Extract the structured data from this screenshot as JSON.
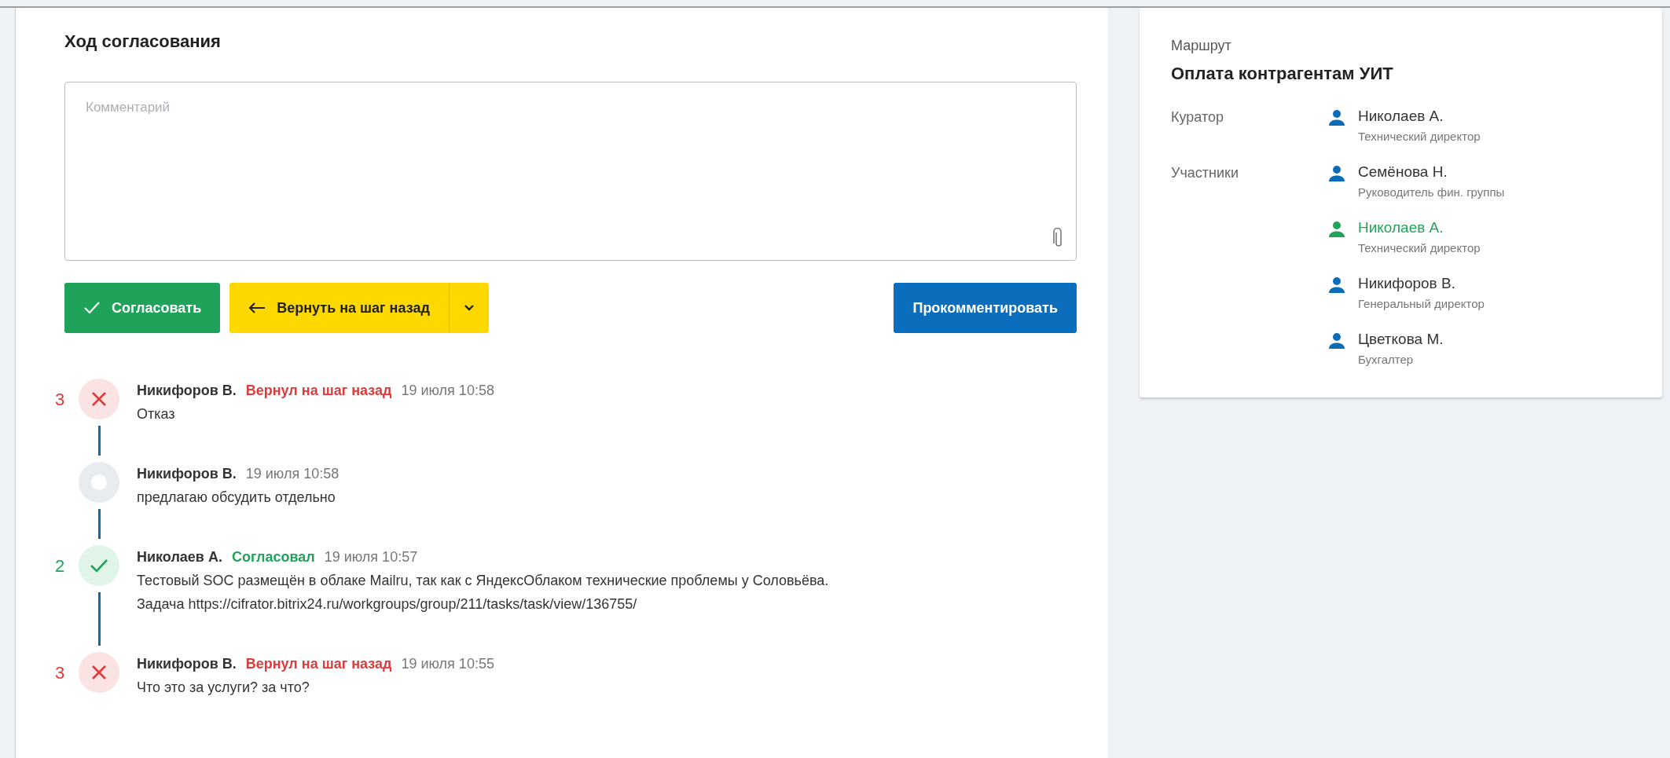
{
  "approval": {
    "title": "Ход согласования",
    "comment": {
      "placeholder": "Комментарий"
    },
    "buttons": [
      {
        "kind": "approve",
        "label": "Согласовать"
      },
      {
        "kind": "return",
        "label": "Вернуть на шаг назад"
      },
      {
        "kind": "comment",
        "label": "Прокомментировать"
      }
    ],
    "history": [
      {
        "kind": "rejected",
        "step": "3",
        "author": "Никифоров В.",
        "action": "Вернул на шаг назад",
        "date": "19 июля 10:58",
        "text": [
          "Отказ"
        ]
      },
      {
        "kind": "comment",
        "author": "Никифоров В.",
        "date": "19 июля 10:58",
        "text": [
          "предлагаю обсудить отдельно"
        ]
      },
      {
        "kind": "approved",
        "step": "2",
        "author": "Николаев А.",
        "action": "Согласовал",
        "date": "19 июля 10:57",
        "text": [
          "Тестовый SOC размещён в облаке Mailru, так как с ЯндексОблаком технические проблемы у Соловьёва.",
          "Задача https://cifrator.bitrix24.ru/workgroups/group/211/tasks/task/view/136755/"
        ]
      },
      {
        "kind": "rejected",
        "step": "3",
        "author": "Никифоров В.",
        "action": "Вернул на шаг назад",
        "date": "19 июля 10:55",
        "text": [
          "Что это за услуги? за что?"
        ]
      }
    ]
  },
  "route": {
    "label": "Маршрут",
    "name": "Оплата контрагентам УИТ",
    "groups": [
      {
        "role": "Куратор",
        "people": [
          {
            "name": "Николаев А.",
            "position": "Технический директор",
            "active": false
          }
        ]
      },
      {
        "role": "Участники",
        "people": [
          {
            "name": "Семёнова Н.",
            "position": "Руководитель фин. группы",
            "active": false
          },
          {
            "name": "Николаев А.",
            "position": "Технический директор",
            "active": true
          },
          {
            "name": "Никифоров В.",
            "position": "Генеральный директор",
            "active": false
          },
          {
            "name": "Цветкова М.",
            "position": "Бухгалтер",
            "active": false
          }
        ]
      }
    ]
  }
}
